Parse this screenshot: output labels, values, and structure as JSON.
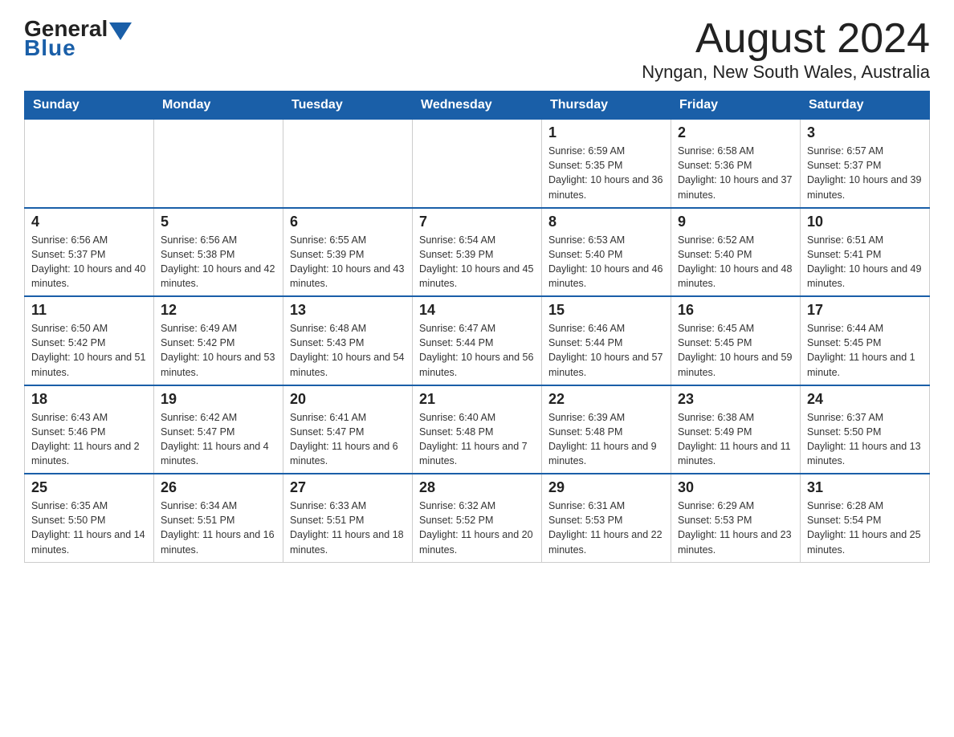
{
  "logo": {
    "general": "General",
    "blue": "Blue"
  },
  "title": "August 2024",
  "subtitle": "Nyngan, New South Wales, Australia",
  "days_of_week": [
    "Sunday",
    "Monday",
    "Tuesday",
    "Wednesday",
    "Thursday",
    "Friday",
    "Saturday"
  ],
  "weeks": [
    [
      {
        "day": "",
        "info": ""
      },
      {
        "day": "",
        "info": ""
      },
      {
        "day": "",
        "info": ""
      },
      {
        "day": "",
        "info": ""
      },
      {
        "day": "1",
        "info": "Sunrise: 6:59 AM\nSunset: 5:35 PM\nDaylight: 10 hours and 36 minutes."
      },
      {
        "day": "2",
        "info": "Sunrise: 6:58 AM\nSunset: 5:36 PM\nDaylight: 10 hours and 37 minutes."
      },
      {
        "day": "3",
        "info": "Sunrise: 6:57 AM\nSunset: 5:37 PM\nDaylight: 10 hours and 39 minutes."
      }
    ],
    [
      {
        "day": "4",
        "info": "Sunrise: 6:56 AM\nSunset: 5:37 PM\nDaylight: 10 hours and 40 minutes."
      },
      {
        "day": "5",
        "info": "Sunrise: 6:56 AM\nSunset: 5:38 PM\nDaylight: 10 hours and 42 minutes."
      },
      {
        "day": "6",
        "info": "Sunrise: 6:55 AM\nSunset: 5:39 PM\nDaylight: 10 hours and 43 minutes."
      },
      {
        "day": "7",
        "info": "Sunrise: 6:54 AM\nSunset: 5:39 PM\nDaylight: 10 hours and 45 minutes."
      },
      {
        "day": "8",
        "info": "Sunrise: 6:53 AM\nSunset: 5:40 PM\nDaylight: 10 hours and 46 minutes."
      },
      {
        "day": "9",
        "info": "Sunrise: 6:52 AM\nSunset: 5:40 PM\nDaylight: 10 hours and 48 minutes."
      },
      {
        "day": "10",
        "info": "Sunrise: 6:51 AM\nSunset: 5:41 PM\nDaylight: 10 hours and 49 minutes."
      }
    ],
    [
      {
        "day": "11",
        "info": "Sunrise: 6:50 AM\nSunset: 5:42 PM\nDaylight: 10 hours and 51 minutes."
      },
      {
        "day": "12",
        "info": "Sunrise: 6:49 AM\nSunset: 5:42 PM\nDaylight: 10 hours and 53 minutes."
      },
      {
        "day": "13",
        "info": "Sunrise: 6:48 AM\nSunset: 5:43 PM\nDaylight: 10 hours and 54 minutes."
      },
      {
        "day": "14",
        "info": "Sunrise: 6:47 AM\nSunset: 5:44 PM\nDaylight: 10 hours and 56 minutes."
      },
      {
        "day": "15",
        "info": "Sunrise: 6:46 AM\nSunset: 5:44 PM\nDaylight: 10 hours and 57 minutes."
      },
      {
        "day": "16",
        "info": "Sunrise: 6:45 AM\nSunset: 5:45 PM\nDaylight: 10 hours and 59 minutes."
      },
      {
        "day": "17",
        "info": "Sunrise: 6:44 AM\nSunset: 5:45 PM\nDaylight: 11 hours and 1 minute."
      }
    ],
    [
      {
        "day": "18",
        "info": "Sunrise: 6:43 AM\nSunset: 5:46 PM\nDaylight: 11 hours and 2 minutes."
      },
      {
        "day": "19",
        "info": "Sunrise: 6:42 AM\nSunset: 5:47 PM\nDaylight: 11 hours and 4 minutes."
      },
      {
        "day": "20",
        "info": "Sunrise: 6:41 AM\nSunset: 5:47 PM\nDaylight: 11 hours and 6 minutes."
      },
      {
        "day": "21",
        "info": "Sunrise: 6:40 AM\nSunset: 5:48 PM\nDaylight: 11 hours and 7 minutes."
      },
      {
        "day": "22",
        "info": "Sunrise: 6:39 AM\nSunset: 5:48 PM\nDaylight: 11 hours and 9 minutes."
      },
      {
        "day": "23",
        "info": "Sunrise: 6:38 AM\nSunset: 5:49 PM\nDaylight: 11 hours and 11 minutes."
      },
      {
        "day": "24",
        "info": "Sunrise: 6:37 AM\nSunset: 5:50 PM\nDaylight: 11 hours and 13 minutes."
      }
    ],
    [
      {
        "day": "25",
        "info": "Sunrise: 6:35 AM\nSunset: 5:50 PM\nDaylight: 11 hours and 14 minutes."
      },
      {
        "day": "26",
        "info": "Sunrise: 6:34 AM\nSunset: 5:51 PM\nDaylight: 11 hours and 16 minutes."
      },
      {
        "day": "27",
        "info": "Sunrise: 6:33 AM\nSunset: 5:51 PM\nDaylight: 11 hours and 18 minutes."
      },
      {
        "day": "28",
        "info": "Sunrise: 6:32 AM\nSunset: 5:52 PM\nDaylight: 11 hours and 20 minutes."
      },
      {
        "day": "29",
        "info": "Sunrise: 6:31 AM\nSunset: 5:53 PM\nDaylight: 11 hours and 22 minutes."
      },
      {
        "day": "30",
        "info": "Sunrise: 6:29 AM\nSunset: 5:53 PM\nDaylight: 11 hours and 23 minutes."
      },
      {
        "day": "31",
        "info": "Sunrise: 6:28 AM\nSunset: 5:54 PM\nDaylight: 11 hours and 25 minutes."
      }
    ]
  ]
}
